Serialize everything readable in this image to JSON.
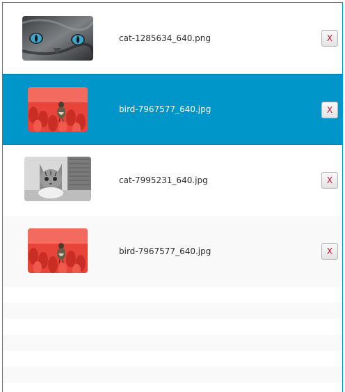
{
  "files": [
    {
      "name": "cat-1285634_640.png",
      "thumbnail": "grey-cat-blue-eyes",
      "remove_label": "X",
      "selected": false
    },
    {
      "name": "bird-7967577_640.jpg",
      "thumbnail": "bird-on-red-tulips",
      "remove_label": "X",
      "selected": true
    },
    {
      "name": "cat-7995231_640.jpg",
      "thumbnail": "tabby-cat-bw",
      "remove_label": "X",
      "selected": false
    },
    {
      "name": "bird-7967577_640.jpg",
      "thumbnail": "bird-on-red-tulips",
      "remove_label": "X",
      "selected": false
    }
  ],
  "colors": {
    "selection": "#0096c9",
    "remove_text": "#c8102e",
    "stripe": "#f9f9f9"
  }
}
